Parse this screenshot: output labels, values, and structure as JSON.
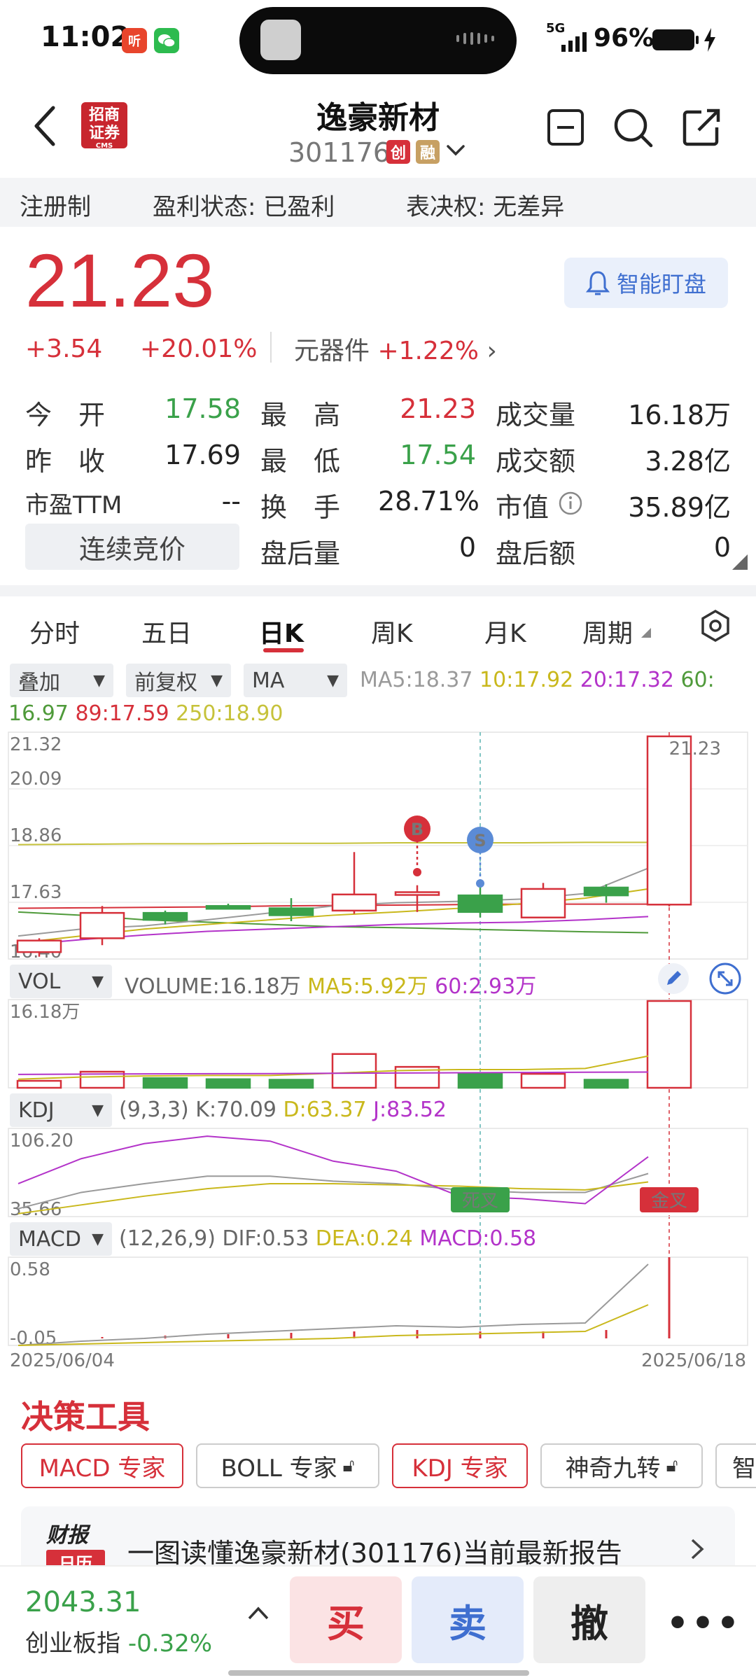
{
  "status_bar": {
    "time": "11:02",
    "network": "5G",
    "battery": "96%"
  },
  "header": {
    "name": "逸豪新材",
    "code": "301176",
    "tags": [
      "创",
      "融"
    ],
    "broker_logo": [
      "招商",
      "证券",
      "CMS"
    ]
  },
  "reg_bar": {
    "item1": "注册制",
    "item2": "盈利状态: 已盈利",
    "item3": "表决权: 无差异"
  },
  "quote": {
    "price": "21.23",
    "change": "+3.54",
    "change_pct": "+20.01%",
    "sector_name": "元器件",
    "sector_pct": "+1.22%",
    "watch_label": "智能盯盘",
    "rows": [
      {
        "l1": "今　开",
        "v1": "17.58",
        "l2": "最　高",
        "v2": "21.23",
        "l3": "成交量",
        "v3": "16.18万"
      },
      {
        "l1": "昨　收",
        "v1": "17.69",
        "l2": "最　低",
        "v2": "17.54",
        "l3": "成交额",
        "v3": "3.28亿"
      },
      {
        "l1": "市盈TTM",
        "v1": "--",
        "l2": "换　手",
        "v2": "28.71%",
        "l3": "市值",
        "v3": "35.89亿"
      }
    ],
    "auction_label": "连续竞价",
    "after_vol_label": "盘后量",
    "after_vol": "0",
    "after_amt_label": "盘后额",
    "after_amt": "0"
  },
  "ktabs": [
    "分时",
    "五日",
    "日K",
    "周K",
    "月K",
    "周期"
  ],
  "controls": {
    "overlay": "叠加",
    "adjust": "前复权",
    "ma": "MA"
  },
  "ma_values": {
    "ma5": "MA5:18.37",
    "ma10": "10:17.92",
    "ma20": "20:17.32",
    "ma60a": "60:",
    "ma60b": "16.97",
    "ma89": "89:17.59",
    "ma250": "250:18.90"
  },
  "kline": {
    "y_labels": [
      "21.32",
      "20.09",
      "18.86",
      "17.63",
      "16.40"
    ],
    "last_price": "21.23",
    "marker_b": "B",
    "marker_s": "S",
    "candles": [
      {
        "o": 16.55,
        "c": 16.8,
        "h": 16.85,
        "l": 16.45
      },
      {
        "o": 16.85,
        "c": 17.4,
        "h": 17.55,
        "l": 16.7
      },
      {
        "o": 17.4,
        "c": 17.25,
        "h": 17.45,
        "l": 17.15
      },
      {
        "o": 17.55,
        "c": 17.5,
        "h": 17.6,
        "l": 17.48
      },
      {
        "o": 17.5,
        "c": 17.35,
        "h": 17.72,
        "l": 17.22
      },
      {
        "o": 17.45,
        "c": 17.8,
        "h": 18.72,
        "l": 17.38
      },
      {
        "o": 17.8,
        "c": 17.85,
        "h": 18.0,
        "l": 17.42
      },
      {
        "o": 17.78,
        "c": 17.42,
        "h": 17.98,
        "l": 17.3
      },
      {
        "o": 17.3,
        "c": 17.92,
        "h": 18.05,
        "l": 17.3
      },
      {
        "o": 17.95,
        "c": 17.78,
        "h": 18.02,
        "l": 17.62
      },
      {
        "o": 17.58,
        "c": 21.23,
        "h": 21.23,
        "l": 17.54
      }
    ]
  },
  "vol": {
    "label": "VOL",
    "volume": "VOLUME:16.18万",
    "ma5": "MA5:5.92万",
    "ma60": "60:2.93万",
    "y_top": "16.18万",
    "values": [
      1.3,
      3.0,
      1.8,
      1.6,
      1.5,
      6.3,
      3.9,
      2.6,
      2.6,
      1.5,
      16.18
    ]
  },
  "kdj": {
    "label": "KDJ",
    "params": "(9,3,3)",
    "k": "K:70.09",
    "d": "D:63.37",
    "j": "J:83.52",
    "y_top": "106.20",
    "y_bot": "35.66",
    "dead_cross": "死叉",
    "golden_cross": "金叉"
  },
  "macd": {
    "label": "MACD",
    "params": "(12,26,9)",
    "dif": "DIF:0.53",
    "dea": "DEA:0.24",
    "macd": "MACD:0.58",
    "y_top": "0.58",
    "y_bot": "-0.05",
    "date_start": "2025/06/04",
    "date_end": "2025/06/18"
  },
  "decision": {
    "title": "决策工具",
    "chips": [
      "MACD 专家",
      "BOLL 专家",
      "KDJ 专家",
      "神奇九转",
      "智"
    ]
  },
  "report": {
    "logo_top": "财报",
    "logo_bottom": "日历",
    "text": "一图读懂逸豪新材(301176)当前最新报告"
  },
  "bottom": {
    "index_value": "2043.31",
    "index_name": "创业板指",
    "index_pct": "-0.32%",
    "buy": "买",
    "sell": "卖",
    "cancel": "撤",
    "more": "•••"
  },
  "colors": {
    "up": "#d6303a",
    "down": "#3aa14a",
    "ma5": "#9a9a9a",
    "ma10": "#c9b81c",
    "ma20": "#b333c9",
    "ma60": "#4f9a3a",
    "ma250": "#c6c23a"
  }
}
